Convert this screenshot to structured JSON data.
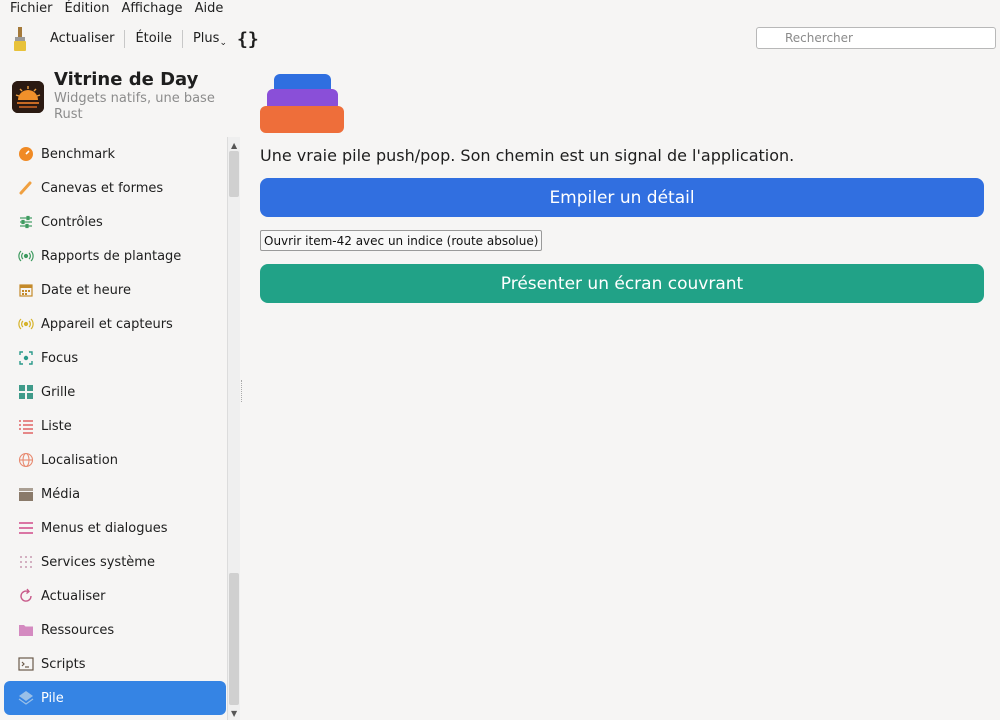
{
  "menubar": {
    "items": [
      "Fichier",
      "Édition",
      "Affichage",
      "Aide"
    ]
  },
  "toolbar": {
    "refresh_label": "Actualiser",
    "star_label": "Étoile",
    "more_label": "Plus",
    "braces_label": "{}",
    "search_placeholder": "Rechercher"
  },
  "app": {
    "title": "Vitrine de Day",
    "subtitle": "Widgets natifs, une base Rust"
  },
  "sidebar": {
    "items": [
      {
        "label": "Benchmark",
        "icon": "gauge-icon",
        "color": "#f08a24"
      },
      {
        "label": "Canevas et formes",
        "icon": "brush-icon",
        "color": "#f0a040"
      },
      {
        "label": "Contrôles",
        "icon": "sliders-icon",
        "color": "#3f9b60"
      },
      {
        "label": "Rapports de plantage",
        "icon": "broadcast-icon",
        "color": "#3f9b60"
      },
      {
        "label": "Date et heure",
        "icon": "calendar-icon",
        "color": "#c48a2a"
      },
      {
        "label": "Appareil et capteurs",
        "icon": "sensor-icon",
        "color": "#d6b32a"
      },
      {
        "label": "Focus",
        "icon": "focus-icon",
        "color": "#2a9a8a"
      },
      {
        "label": "Grille",
        "icon": "grid-icon",
        "color": "#3f9b8a"
      },
      {
        "label": "Liste",
        "icon": "list-icon",
        "color": "#e05a5a"
      },
      {
        "label": "Localisation",
        "icon": "globe-icon",
        "color": "#e88a70"
      },
      {
        "label": "Média",
        "icon": "clapper-icon",
        "color": "#8a7a6a"
      },
      {
        "label": "Menus et dialogues",
        "icon": "menu-icon",
        "color": "#d04a8a"
      },
      {
        "label": "Services système",
        "icon": "dots-icon",
        "color": "#c89ab0"
      },
      {
        "label": "Actualiser",
        "icon": "refresh-icon",
        "color": "#c85a8a"
      },
      {
        "label": "Ressources",
        "icon": "folder-icon",
        "color": "#d48ac0"
      },
      {
        "label": "Scripts",
        "icon": "terminal-icon",
        "color": "#6a5a4a"
      },
      {
        "label": "Pile",
        "icon": "layers-icon",
        "color": "#9ac0e8",
        "active": true
      }
    ]
  },
  "main": {
    "headline": "Une vraie pile push/pop. Son chemin est un signal de l'application.",
    "push_button": "Empiler un détail",
    "open_item_button": "Ouvrir item-42 avec un indice (route absolue)",
    "present_button": "Présenter un écran couvrant"
  },
  "colors": {
    "accent_blue": "#316fe0",
    "teal": "#21a287",
    "selection": "#3584e4"
  }
}
